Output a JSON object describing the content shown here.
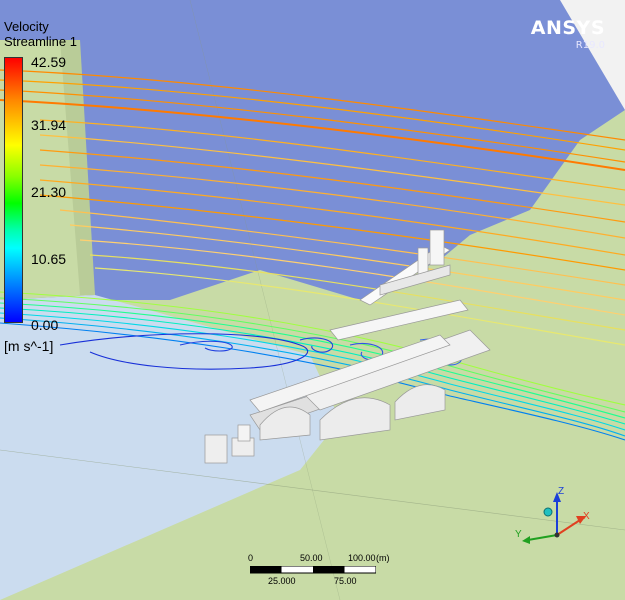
{
  "legend": {
    "title": "Velocity",
    "subtitle": "Streamline 1",
    "ticks": [
      "42.59",
      "31.94",
      "21.30",
      "10.65",
      "0.00"
    ],
    "units": "[m s^-1]"
  },
  "brand": {
    "name": "ANSYS",
    "version": "R19.0"
  },
  "scale_bar": {
    "top_labels": [
      "0",
      "50.00",
      "100.00",
      "(m)"
    ],
    "bottom_labels": [
      "25.000",
      "75.00"
    ]
  },
  "axes": {
    "x": "X",
    "y": "Y",
    "z": "Z"
  },
  "colors": {
    "background": "#7a8fd6",
    "ground": "#c8dba6",
    "water_plane": "#c9d9ec",
    "structure": "#f0f0f0"
  }
}
